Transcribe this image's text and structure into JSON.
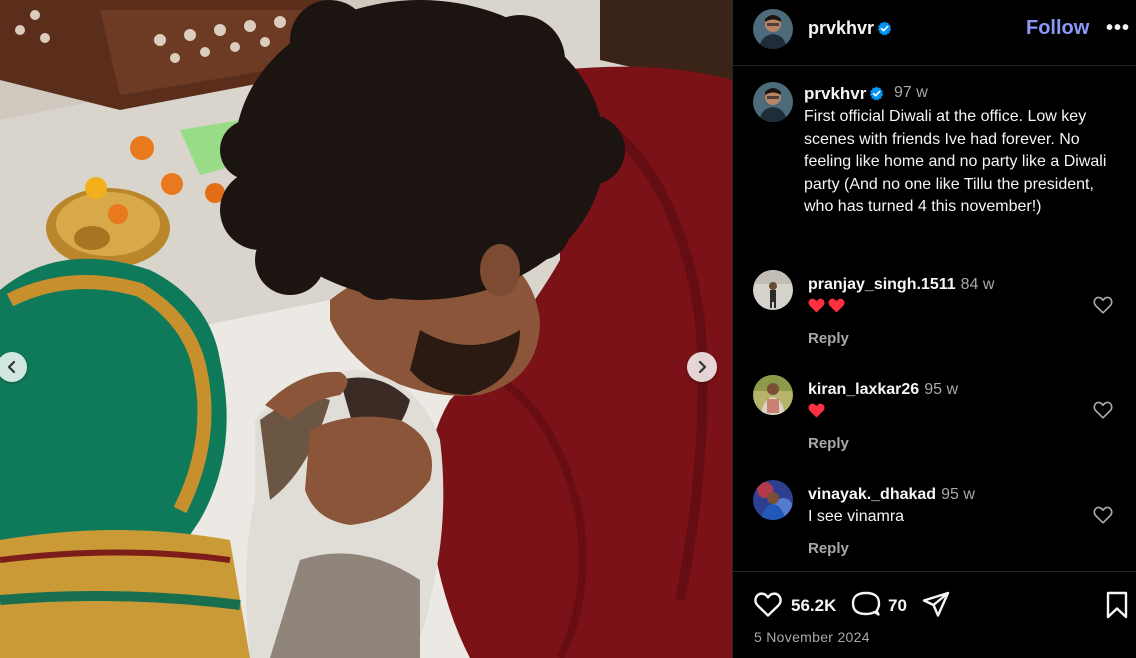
{
  "header": {
    "username": "prvkhvr",
    "follow_label": "Follow",
    "more_label": "•••"
  },
  "caption": {
    "username": "prvkhvr",
    "time": "97 w",
    "text": "First official Diwali at the office. Low key scenes with friends Ive had forever. No feeling like home and no party like a Diwali party (And no one like Tillu the president, who has turned 4 this november!)"
  },
  "comments": [
    {
      "username": "pranjay_singh.1511",
      "time": "84 w",
      "text": "",
      "hearts": 2,
      "reply_label": "Reply"
    },
    {
      "username": "kiran_laxkar26",
      "time": "95 w",
      "text": "",
      "hearts": 1,
      "reply_label": "Reply"
    },
    {
      "username": "vinayak._dhakad",
      "time": "95 w",
      "text": "I see vinamra",
      "hearts": 0,
      "reply_label": "Reply"
    }
  ],
  "actions": {
    "likes": "56.2K",
    "comments": "70",
    "date": "5 November 2024"
  },
  "icons": {
    "verified": "verified-badge-icon",
    "like": "heart-outline-icon",
    "comment": "speech-bubble-icon",
    "share": "paper-plane-icon",
    "save": "bookmark-icon",
    "prev": "chevron-left-icon",
    "next": "chevron-right-icon"
  },
  "colors": {
    "follow": "#8b98f9",
    "verified": "#0095f6",
    "heart_emoji": "#ff3040",
    "muted": "#a8a8a8",
    "background": "#000000"
  }
}
